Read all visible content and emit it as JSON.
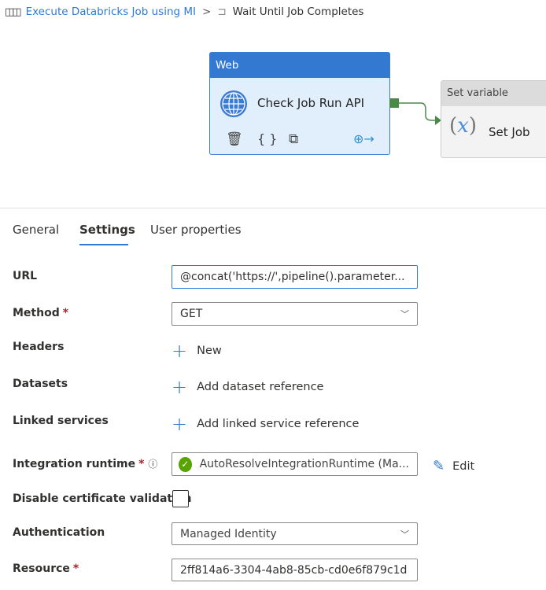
{
  "breadcrumb": {
    "pipeline": "Execute Databricks Job using MI",
    "separator": ">",
    "activity": "Wait Until Job Completes"
  },
  "canvas": {
    "web_node": {
      "type": "Web",
      "name": "Check Job Run API"
    },
    "setvar_node": {
      "type": "Set variable",
      "name": "Set Job"
    }
  },
  "tabs": [
    {
      "label": "General"
    },
    {
      "label": "Settings"
    },
    {
      "label": "User properties"
    }
  ],
  "form": {
    "url": {
      "label": "URL",
      "value": "@concat('https://',pipeline().parameter..."
    },
    "method": {
      "label": "Method",
      "required": "*",
      "value": "GET"
    },
    "headers": {
      "label": "Headers",
      "action": "New"
    },
    "datasets": {
      "label": "Datasets",
      "action": "Add dataset reference"
    },
    "linked": {
      "label": "Linked services",
      "action": "Add linked service reference"
    },
    "ir": {
      "label": "Integration runtime",
      "required": "*",
      "value": "AutoResolveIntegrationRuntime (Ma...",
      "edit": "Edit"
    },
    "cert": {
      "label": "Disable certificate validation"
    },
    "auth": {
      "label": "Authentication",
      "value": "Managed Identity"
    },
    "resource": {
      "label": "Resource",
      "required": "*",
      "value": "2ff814a6-3304-4ab8-85cb-cd0e6f879c1d"
    }
  },
  "colors": {
    "accent": "#2f7ad2",
    "node_header": "#3479d1",
    "success": "#57a300",
    "required": "#a4262c"
  }
}
